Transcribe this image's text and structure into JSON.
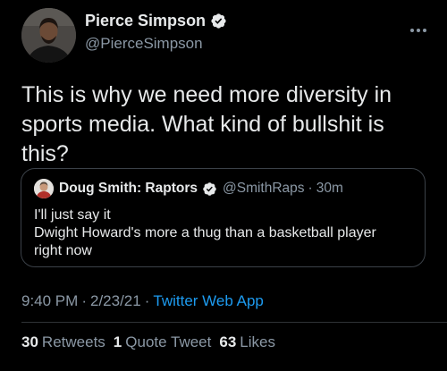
{
  "tweet": {
    "author": {
      "name": "Pierce Simpson",
      "handle": "@PierceSimpson",
      "verified": true
    },
    "text": "This is why we need more diversity in sports media. What kind of bullshit is this?",
    "quoted_tweet": {
      "author_name": "Doug Smith: Raptors",
      "handle": "@SmithRaps",
      "separator": "·",
      "time": "30m",
      "verified": true,
      "lines": [
        "I'll just say it",
        "Dwight Howard's more a thug than a basketball player",
        "right now"
      ]
    },
    "meta": {
      "time": "9:40 PM",
      "separator": "·",
      "date": "2/23/21",
      "source": "Twitter Web App"
    },
    "stats": {
      "retweets_count": "30",
      "retweets_label": "Retweets",
      "quote_tweets_count": "1",
      "quote_tweets_label": "Quote Tweet",
      "likes_count": "63",
      "likes_label": "Likes"
    }
  },
  "colors": {
    "background": "#000000",
    "text_primary": "#e7e9ea",
    "text_secondary": "#8b98a5",
    "link_blue": "#1d9bf0",
    "verified_blue": "#1d9bf0",
    "border": "#3b4148"
  },
  "icons": {
    "verified": "verified-badge-icon",
    "more": "more-options-icon"
  }
}
